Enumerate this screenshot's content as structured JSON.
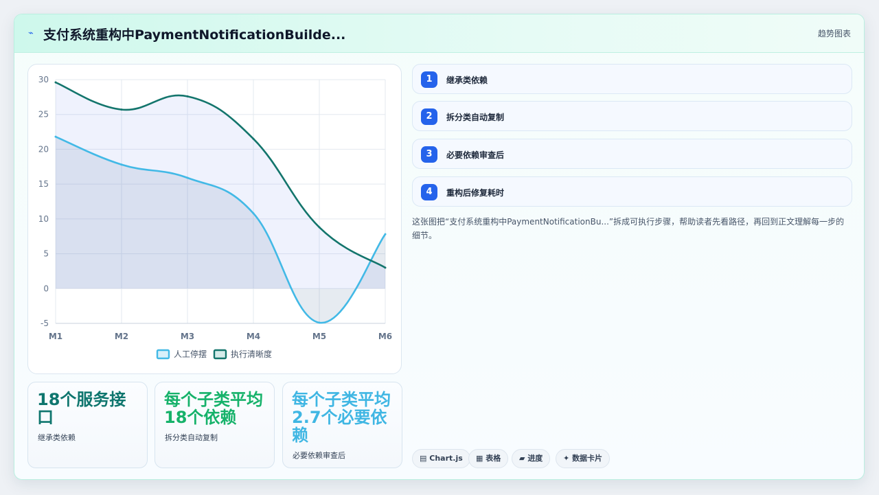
{
  "header": {
    "icon": "trend-icon",
    "title": "支付系统重构中PaymentNotificationBuilde...",
    "tag": "趋势图表"
  },
  "chart_data": {
    "type": "line",
    "categories": [
      "M1",
      "M2",
      "M3",
      "M4",
      "M5",
      "M6"
    ],
    "series": [
      {
        "name": "人工停摆",
        "values": [
          21.8,
          17.8,
          15.9,
          10.8,
          -4.9,
          7.8
        ],
        "color": "#42b9e6",
        "fill": true
      },
      {
        "name": "执行清晰度",
        "values": [
          29.6,
          25.7,
          27.6,
          21.5,
          8.8,
          3.0
        ],
        "color": "#13756c",
        "fill": true
      }
    ],
    "yticks": [
      30,
      25,
      20,
      15,
      10,
      5,
      0,
      -5
    ],
    "ylim": [
      -5,
      30
    ],
    "grid": true,
    "legend": "bottom"
  },
  "stats": [
    {
      "value": "18个服务接口",
      "label": "继承类依赖",
      "color": "#0f766e"
    },
    {
      "value": "每个子类平均18个依赖",
      "label": "拆分类自动复制",
      "color": "#16b26a"
    },
    {
      "value": "每个子类平均2.7个必要依赖",
      "label": "必要依赖审查后",
      "color": "#3fb6e3"
    }
  ],
  "steps": [
    {
      "num": "1",
      "text": "继承类依赖"
    },
    {
      "num": "2",
      "text": "拆分类自动复制"
    },
    {
      "num": "3",
      "text": "必要依赖审查后"
    },
    {
      "num": "4",
      "text": "重构后修复耗时"
    }
  ],
  "description": "这张图把“支付系统重构中PaymentNotificationBu...”拆成可执行步骤，帮助读者先看路径，再回到正文理解每一步的细节。",
  "chips": [
    {
      "icon": "▤",
      "label": "Chart.js"
    },
    {
      "icon": "▦",
      "label": "表格"
    },
    {
      "icon": "▰",
      "label": "进度"
    },
    {
      "icon": "✦",
      "label": "数据卡片"
    }
  ]
}
